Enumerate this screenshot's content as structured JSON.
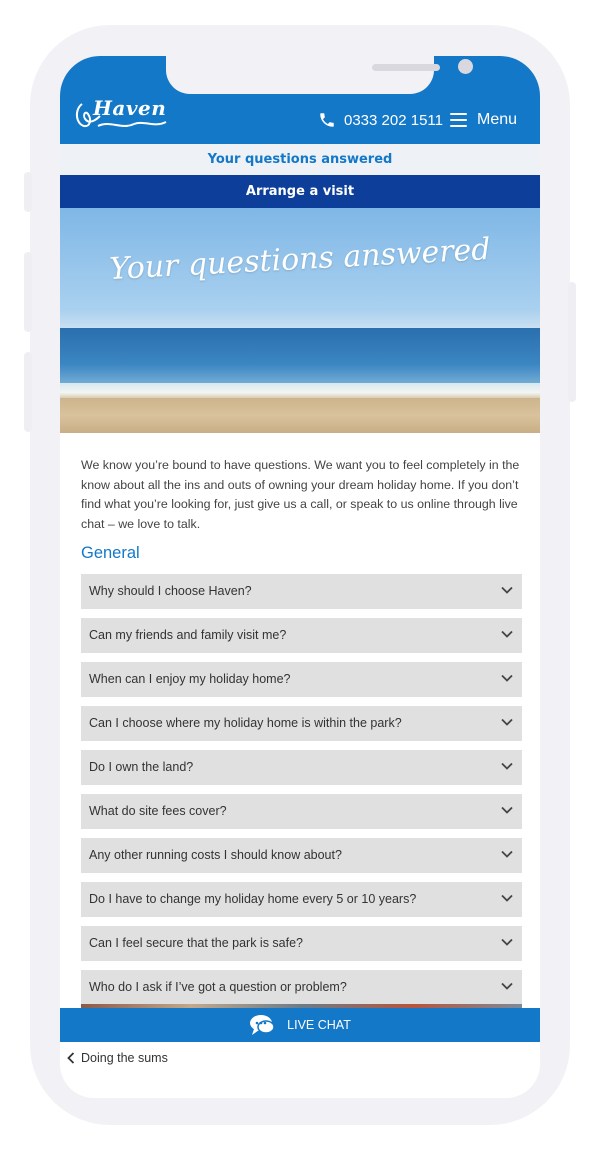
{
  "header": {
    "logo_text": "Haven",
    "phone": "0333 202 1511",
    "menu_label": "Menu"
  },
  "subnav": {
    "title": "Your questions answered",
    "arrange_label": "Arrange a visit"
  },
  "hero": {
    "title": "Your questions answered"
  },
  "intro": "We know you’re bound to have questions. We want you to feel completely in the know about all the ins and outs of owning your dream holiday home. If you don’t find what you’re looking for, just give us a call, or speak to us online through live chat – we love to talk.",
  "section_title": "General",
  "faqs": [
    {
      "question": "Why should I choose Haven?"
    },
    {
      "question": "Can my friends and family visit me?"
    },
    {
      "question": "When can I enjoy my holiday home?"
    },
    {
      "question": "Can I choose where my holiday home is within the park?"
    },
    {
      "question": "Do I own the land?"
    },
    {
      "question": "What do site fees cover?"
    },
    {
      "question": "Any other running costs I should know about?"
    },
    {
      "question": "Do I have to change my holiday home every 5 or 10 years?"
    },
    {
      "question": "Can I feel secure that the park is safe?"
    },
    {
      "question": "Who do I ask if I’ve got a question or problem?"
    }
  ],
  "live_chat_label": "LIVE CHAT",
  "back_link": "Doing the sums",
  "colors": {
    "brand_blue": "#1478c8",
    "navy": "#0c3e9a",
    "faq_bg": "#e0e0e0"
  },
  "icons": [
    "phone-icon",
    "hamburger-icon",
    "chevron-down-icon",
    "chat-bubbles-icon",
    "chevron-left-icon"
  ]
}
